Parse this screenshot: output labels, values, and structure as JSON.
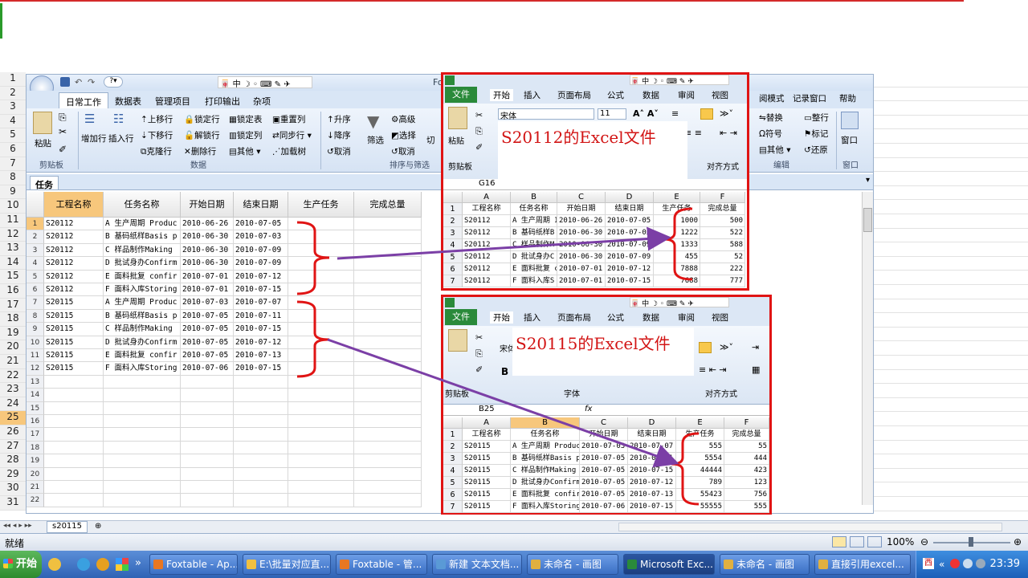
{
  "foxtable": {
    "title_fragment": "Fo",
    "tabs": [
      "日常工作",
      "数据表",
      "管理项目",
      "打印输出",
      "杂项"
    ],
    "ribbon": {
      "paste": "粘贴",
      "clipboard_group": "剪贴板",
      "add_row": "增加行",
      "insert_row": "插入行",
      "move_up": "上移行",
      "move_down": "下移行",
      "clone_row": "克隆行",
      "lock_row": "锁定行",
      "unlock_row": "解锁行",
      "delete_row": "删除行",
      "lock_table": "锁定表",
      "lock_column": "锁定列",
      "other": "其他",
      "reset_column": "重置列",
      "sync_row": "同步行",
      "load_tree": "加载树",
      "data_group": "数据",
      "asc": "升序",
      "desc": "降序",
      "cancel": "取消",
      "filter": "筛选",
      "advanced": "高级",
      "select": "选择",
      "cancel2": "取消",
      "switch_fragment": "切",
      "sort_group": "排序与筛选",
      "right_items": [
        "阅模式",
        "记录窗口",
        "帮助",
        "替换",
        "符号",
        "其他",
        "整行",
        "标记",
        "还原",
        "窗口"
      ],
      "edit_group": "编辑",
      "window_group": "窗口"
    },
    "doc_tab": "任务",
    "columns": [
      "工程名称",
      "任务名称",
      "开始日期",
      "结束日期",
      "生产任务",
      "完成总量"
    ],
    "rows": [
      [
        "S20112",
        "A 生产周期 Produc",
        "2010-06-26",
        "2010-07-05",
        "",
        ""
      ],
      [
        "S20112",
        "B 基码纸样Basis p",
        "2010-06-30",
        "2010-07-03",
        "",
        ""
      ],
      [
        "S20112",
        "C 样品制作Making",
        "2010-06-30",
        "2010-07-09",
        "",
        ""
      ],
      [
        "S20112",
        "D 批试身办Confirm",
        "2010-06-30",
        "2010-07-09",
        "",
        ""
      ],
      [
        "S20112",
        "E 面料批复 confir",
        "2010-07-01",
        "2010-07-12",
        "",
        ""
      ],
      [
        "S20112",
        "F 面料入库Storing",
        "2010-07-01",
        "2010-07-15",
        "",
        ""
      ],
      [
        "S20115",
        "A 生产周期 Produc",
        "2010-07-03",
        "2010-07-07",
        "",
        ""
      ],
      [
        "S20115",
        "B 基码纸样Basis p",
        "2010-07-05",
        "2010-07-11",
        "",
        ""
      ],
      [
        "S20115",
        "C 样品制作Making",
        "2010-07-05",
        "2010-07-15",
        "",
        ""
      ],
      [
        "S20115",
        "D 批试身办Confirm",
        "2010-07-05",
        "2010-07-12",
        "",
        ""
      ],
      [
        "S20115",
        "E 面料批复 confir",
        "2010-07-05",
        "2010-07-13",
        "",
        ""
      ],
      [
        "S20115",
        "F 面料入库Storing",
        "2010-07-06",
        "2010-07-15",
        "",
        ""
      ]
    ],
    "row_numbers": [
      "1",
      "2",
      "3",
      "4",
      "5",
      "6",
      "7",
      "8",
      "9",
      "10",
      "11",
      "12",
      "13",
      "14",
      "15",
      "16",
      "17",
      "18",
      "19",
      "20",
      "21",
      "22"
    ]
  },
  "excel_row_numbers": [
    "1",
    "2",
    "3",
    "4",
    "5",
    "6",
    "7",
    "8",
    "9",
    "10",
    "11",
    "12",
    "13",
    "14",
    "15",
    "16",
    "17",
    "18",
    "19",
    "20",
    "21",
    "22",
    "23",
    "24",
    "25",
    "26",
    "27",
    "28",
    "29",
    "30",
    "31"
  ],
  "excel1": {
    "tabs": [
      "文件",
      "开始",
      "插入",
      "页面布局",
      "公式",
      "数据",
      "审阅",
      "视图"
    ],
    "font_name": "宋体",
    "font_size": "11",
    "paste": "粘贴",
    "clipboard": "剪贴板",
    "align_group": "对齐方式",
    "callout": "S20112的Excel文件",
    "name_box": "G16",
    "col_headers": [
      "A",
      "B",
      "C",
      "D",
      "E",
      "F"
    ],
    "header_row": [
      "工程名称",
      "任务名称",
      "开始日期",
      "结束日期",
      "生产任务",
      "完成总量"
    ],
    "rows": [
      [
        "S20112",
        "A 生产周期 I",
        "2010-06-26",
        "2010-07-05",
        "1000",
        "500"
      ],
      [
        "S20112",
        "B 基码纸样B",
        "2010-06-30",
        "2010-07-03",
        "1222",
        "522"
      ],
      [
        "S20112",
        "C 样品制作M",
        "2010-06-30",
        "2010-07-09",
        "1333",
        "588"
      ],
      [
        "S20112",
        "D 批试身办C",
        "2010-06-30",
        "2010-07-09",
        "455",
        "52"
      ],
      [
        "S20112",
        "E 面料批复 c",
        "2010-07-01",
        "2010-07-12",
        "7888",
        "222"
      ],
      [
        "S20112",
        "F 面料入库S",
        "2010-07-01",
        "2010-07-15",
        "7688",
        "777"
      ]
    ]
  },
  "excel2": {
    "tabs": [
      "文件",
      "开始",
      "插入",
      "页面布局",
      "公式",
      "数据",
      "审阅",
      "视图"
    ],
    "font_name": "宋体",
    "clipboard": "剪贴板",
    "font_group": "字体",
    "align_group": "对齐方式",
    "callout": "S20115的Excel文件",
    "name_box": "B25",
    "fx": "fx",
    "col_headers": [
      "A",
      "B",
      "C",
      "D",
      "E",
      "F"
    ],
    "header_row": [
      "工程名称",
      "任务名称",
      "开始日期",
      "结束日期",
      "生产任务",
      "完成总量"
    ],
    "rows": [
      [
        "S20115",
        "A 生产周期 Produc",
        "2010-07-03",
        "2010-07-07",
        "555",
        "55"
      ],
      [
        "S20115",
        "B 基码纸样Basis p",
        "2010-07-05",
        "2010-07-11",
        "5554",
        "444"
      ],
      [
        "S20115",
        "C 样品制作Making",
        "2010-07-05",
        "2010-07-15",
        "44444",
        "423"
      ],
      [
        "S20115",
        "D 批试身办Confirm",
        "2010-07-05",
        "2010-07-12",
        "789",
        "123"
      ],
      [
        "S20115",
        "E 面料批复 confir",
        "2010-07-05",
        "2010-07-13",
        "55423",
        "756"
      ],
      [
        "S20115",
        "F 面料入库Storing",
        "2010-07-06",
        "2010-07-15",
        "55555",
        "555"
      ]
    ]
  },
  "sheet_tab": "s20115",
  "status": {
    "ready": "就绪",
    "zoom": "100%"
  },
  "taskbar": {
    "start": "开始",
    "items": [
      "Foxtable - Ap...",
      "E:\\批量对应直...",
      "Foxtable - 管...",
      "新建 文本文档...",
      "未命名 - 画图",
      "Microsoft Exc...",
      "未命名 - 画图",
      "直接引用excel..."
    ],
    "clock": "23:39"
  },
  "colors": {
    "callout_red": "#d21414",
    "arrow_purple": "#7b3fa6",
    "excel_green": "#2a8a3a"
  }
}
